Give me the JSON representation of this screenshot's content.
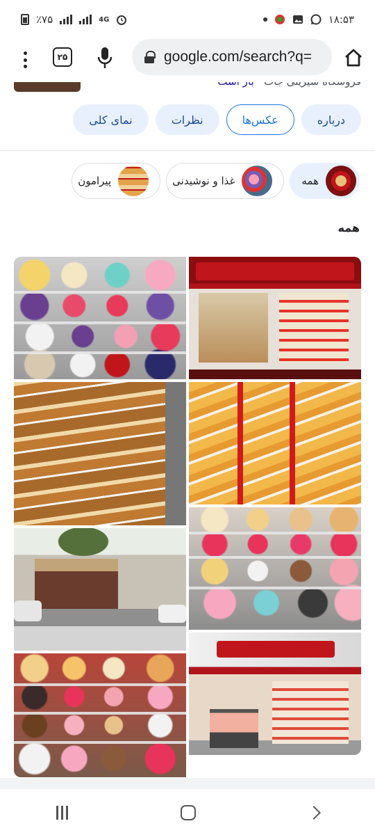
{
  "status_bar": {
    "time": "۱۸:۵۳",
    "battery": "٪۷۵",
    "network": "4G",
    "icons": [
      "whatsapp-icon",
      "gallery-icon",
      "app-icon",
      "dot-icon",
      "alarm-icon",
      "signal-icon",
      "battery-icon"
    ]
  },
  "browser": {
    "tab_count": "۲۵",
    "url": "google.com/search?q=",
    "icons": [
      "menu-icon",
      "tabs-icon",
      "mic-icon",
      "lock-icon",
      "home-icon"
    ]
  },
  "partial_header": {
    "text": "فروشگاه شیرینی جات",
    "link": "باز است"
  },
  "tabs": [
    {
      "label": "نمای کلی",
      "active": false
    },
    {
      "label": "نظرات",
      "active": false
    },
    {
      "label": "عکس‌ها",
      "active": true
    },
    {
      "label": "درباره",
      "active": false
    }
  ],
  "chips": [
    {
      "label": "همه",
      "selected": true
    },
    {
      "label": "غذا و نوشیدنی",
      "selected": false
    },
    {
      "label": "پیرامون",
      "selected": false
    }
  ],
  "section_title": "همه",
  "photos": [
    {
      "name": "cake-display-photo"
    },
    {
      "name": "shop-front-red-photo"
    },
    {
      "name": "pastry-shelves-photo"
    },
    {
      "name": "pastry-trays-red-photo"
    },
    {
      "name": "street-view-photo"
    },
    {
      "name": "cake-display-2-photo"
    },
    {
      "name": "cake-display-3-photo"
    },
    {
      "name": "shop-interior-photo"
    }
  ],
  "colors": {
    "tab_bg": "#e8f0fe",
    "tab_active_border": "#1a73e8",
    "shop_red": "#c0161b"
  }
}
